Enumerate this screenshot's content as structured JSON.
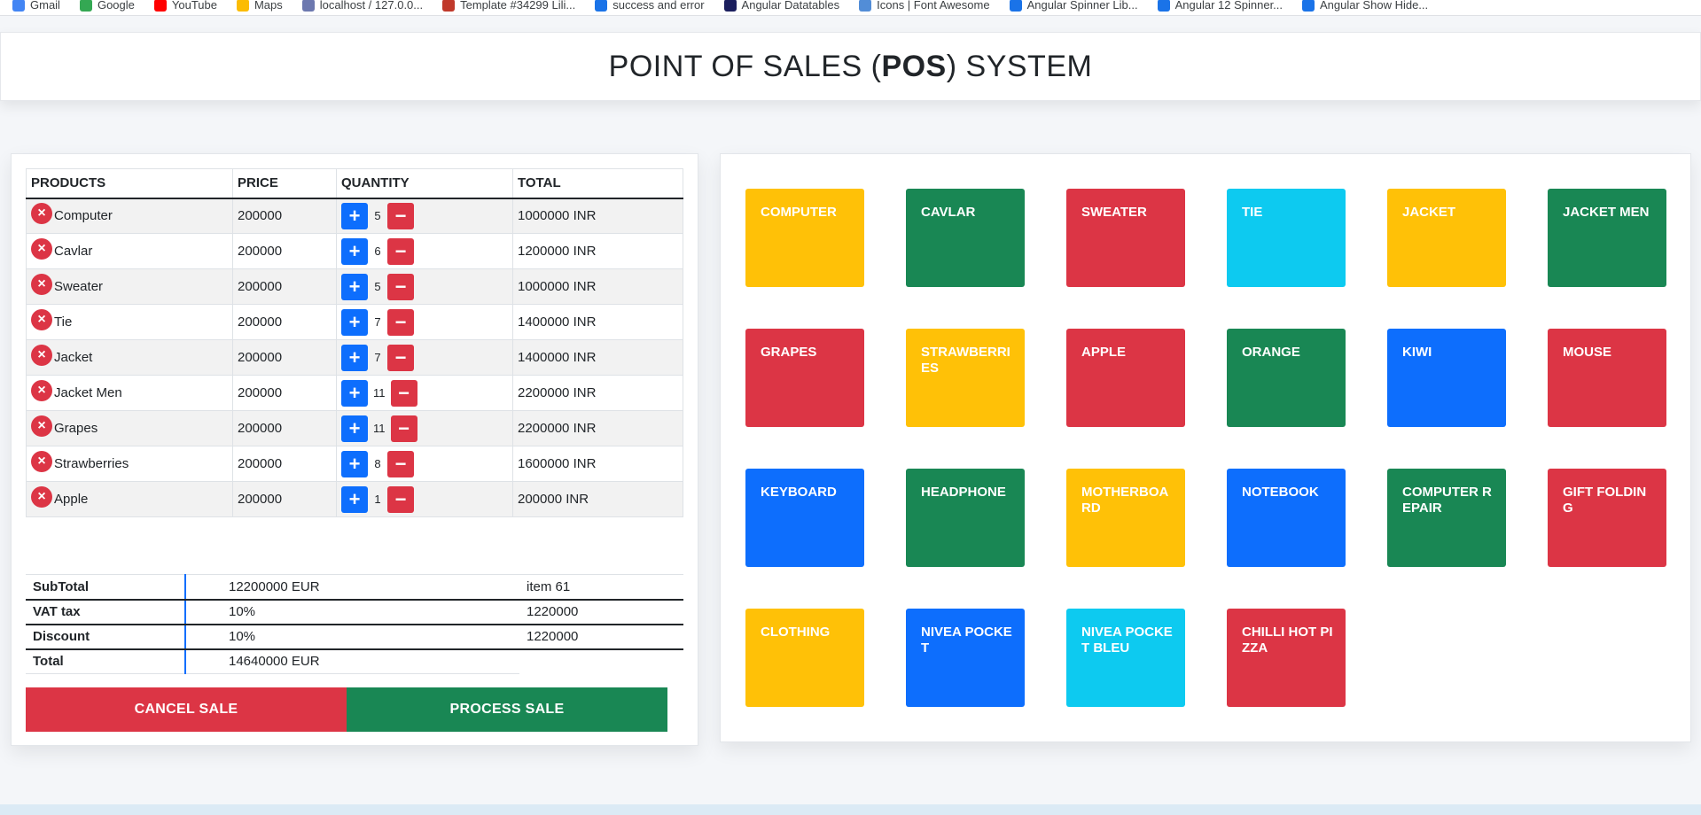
{
  "colors": {
    "blue": "#0d6efd",
    "red": "#dc3545",
    "green": "#198754",
    "yellow": "#ffc107",
    "cyan": "#0dcaf0"
  },
  "bookmarks": [
    {
      "label": "Gmail",
      "icon": "gmail-icon",
      "color": "#4285f4"
    },
    {
      "label": "Google",
      "icon": "google-icon",
      "color": "#34a853"
    },
    {
      "label": "YouTube",
      "icon": "youtube-icon",
      "color": "#ff0000"
    },
    {
      "label": "Maps",
      "icon": "maps-icon",
      "color": "#fbbc04"
    },
    {
      "label": "localhost / 127.0.0...",
      "icon": "phpmyadmin-icon",
      "color": "#6c78af"
    },
    {
      "label": "Template #34299 Lili...",
      "icon": "template-icon",
      "color": "#c0392b"
    },
    {
      "label": "success and error",
      "icon": "doc-icon",
      "color": "#1a73e8"
    },
    {
      "label": "Angular Datatables",
      "icon": "angular-icon",
      "color": "#1b1f5e"
    },
    {
      "label": "Icons | Font Awesome",
      "icon": "fontawesome-icon",
      "color": "#528dd7"
    },
    {
      "label": "Angular Spinner Lib...",
      "icon": "link-icon",
      "color": "#1a73e8"
    },
    {
      "label": "Angular 12 Spinner...",
      "icon": "link-icon",
      "color": "#1a73e8"
    },
    {
      "label": "Angular Show Hide...",
      "icon": "link-icon",
      "color": "#1a73e8"
    }
  ],
  "header": {
    "title_prefix": "POINT OF SALES (",
    "title_bold": "POS",
    "title_suffix": ") SYSTEM"
  },
  "cart": {
    "columns": [
      "PRODUCTS",
      "PRICE",
      "QUANTITY",
      "TOTAL"
    ],
    "remove_icon": "×",
    "plus_icon": "+",
    "minus_icon": "−",
    "rows": [
      {
        "name": "Computer",
        "price": "200000",
        "qty": "5",
        "total": "1000000 INR"
      },
      {
        "name": "Cavlar",
        "price": "200000",
        "qty": "6",
        "total": "1200000 INR"
      },
      {
        "name": "Sweater",
        "price": "200000",
        "qty": "5",
        "total": "1000000 INR"
      },
      {
        "name": "Tie",
        "price": "200000",
        "qty": "7",
        "total": "1400000 INR"
      },
      {
        "name": "Jacket",
        "price": "200000",
        "qty": "7",
        "total": "1400000 INR"
      },
      {
        "name": "Jacket Men",
        "price": "200000",
        "qty": "11",
        "total": "2200000 INR"
      },
      {
        "name": "Grapes",
        "price": "200000",
        "qty": "11",
        "total": "2200000 INR"
      },
      {
        "name": "Strawberries",
        "price": "200000",
        "qty": "8",
        "total": "1600000 INR"
      },
      {
        "name": "Apple",
        "price": "200000",
        "qty": "1",
        "total": "200000 INR"
      }
    ]
  },
  "summary": {
    "subtotal_label": "SubTotal",
    "subtotal_value": "12200000 EUR",
    "subtotal_extra": "item 61",
    "vat_label": "VAT tax",
    "vat_value": "10%",
    "vat_extra": "1220000",
    "discount_label": "Discount",
    "discount_value": "10%",
    "discount_extra": "1220000",
    "total_label": "Total",
    "total_value": "14640000 EUR"
  },
  "actions": {
    "cancel_label": "CANCEL SALE",
    "process_label": "PROCESS SALE"
  },
  "products": [
    {
      "label": "COMPUTER",
      "color": "#ffc107"
    },
    {
      "label": "CAVLAR",
      "color": "#198754"
    },
    {
      "label": "SWEATER",
      "color": "#dc3545"
    },
    {
      "label": "TIE",
      "color": "#0dcaf0"
    },
    {
      "label": "JACKET",
      "color": "#ffc107"
    },
    {
      "label": "JACKET MEN",
      "color": "#198754"
    },
    {
      "label": "GRAPES",
      "color": "#dc3545"
    },
    {
      "label": "STRAWBERRIES",
      "color": "#ffc107"
    },
    {
      "label": "APPLE",
      "color": "#dc3545"
    },
    {
      "label": "ORANGE",
      "color": "#198754"
    },
    {
      "label": "KIWI",
      "color": "#0d6efd"
    },
    {
      "label": "MOUSE",
      "color": "#dc3545"
    },
    {
      "label": "KEYBOARD",
      "color": "#0d6efd"
    },
    {
      "label": "HEADPHONE",
      "color": "#198754"
    },
    {
      "label": "MOTHERBOARD",
      "color": "#ffc107"
    },
    {
      "label": "NOTEBOOK",
      "color": "#0d6efd"
    },
    {
      "label": "COMPUTER REPAIR",
      "color": "#198754"
    },
    {
      "label": "GIFT FOLDING",
      "color": "#dc3545"
    },
    {
      "label": "CLOTHING",
      "color": "#ffc107"
    },
    {
      "label": "NIVEA POCKET",
      "color": "#0d6efd"
    },
    {
      "label": "NIVEA POCKET BLEU",
      "color": "#0dcaf0"
    },
    {
      "label": "CHILLI HOT PIZZA",
      "color": "#dc3545"
    }
  ]
}
